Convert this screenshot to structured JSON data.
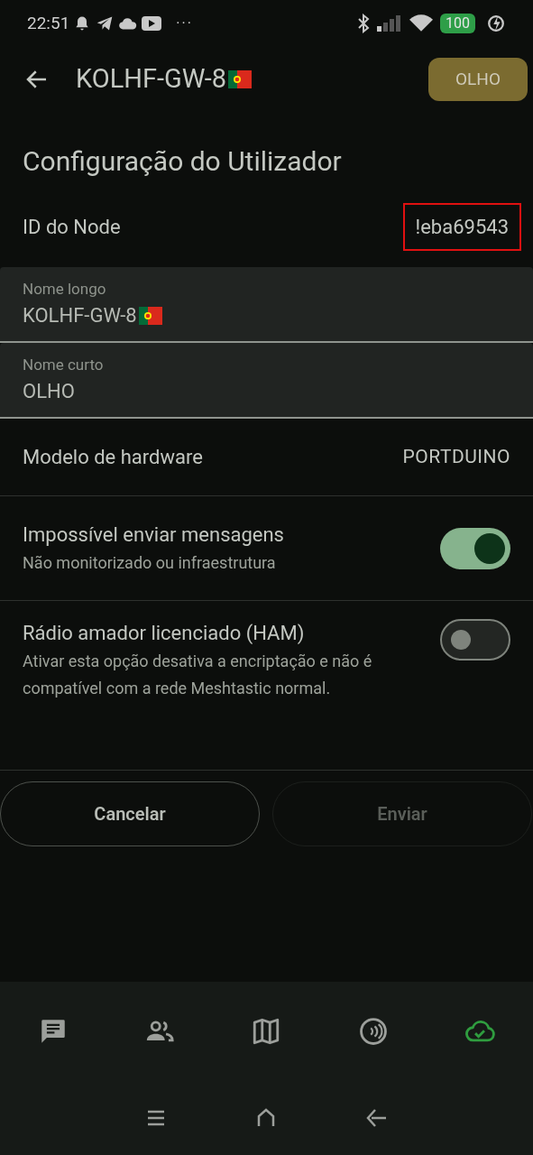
{
  "status_bar": {
    "time": "22:51",
    "more": "···",
    "battery": "100"
  },
  "top_bar": {
    "title": "KOLHF-GW-8",
    "badge": "OLHO"
  },
  "section_title": "Configuração do Utilizador",
  "node_id": {
    "label": "ID do Node",
    "value": "!eba69543",
    "highlighted": true
  },
  "fields": [
    {
      "label": "Nome longo",
      "value": "KOLHF-GW-8",
      "flag": true
    },
    {
      "label": "Nome curto",
      "value": "OLHO",
      "flag": false
    }
  ],
  "hardware": {
    "label": "Modelo de hardware",
    "value": "PORTDUINO"
  },
  "toggles": [
    {
      "title": "Impossível enviar mensagens",
      "subtitle": "Não monitorizado ou infraestrutura",
      "on": true
    },
    {
      "title": "Rádio amador licenciado (HAM)",
      "subtitle": "Ativar esta opção desativa a encriptação e não é compatível com a rede Meshtastic normal.",
      "on": false
    }
  ],
  "buttons": [
    {
      "label": "Cancelar",
      "disabled": false
    },
    {
      "label": "Enviar",
      "disabled": true
    }
  ],
  "nav": [
    {
      "kind": "messages",
      "selected": false
    },
    {
      "kind": "nodes",
      "selected": false
    },
    {
      "kind": "map",
      "selected": false
    },
    {
      "kind": "channels",
      "selected": false
    },
    {
      "kind": "connection",
      "selected": true
    }
  ]
}
